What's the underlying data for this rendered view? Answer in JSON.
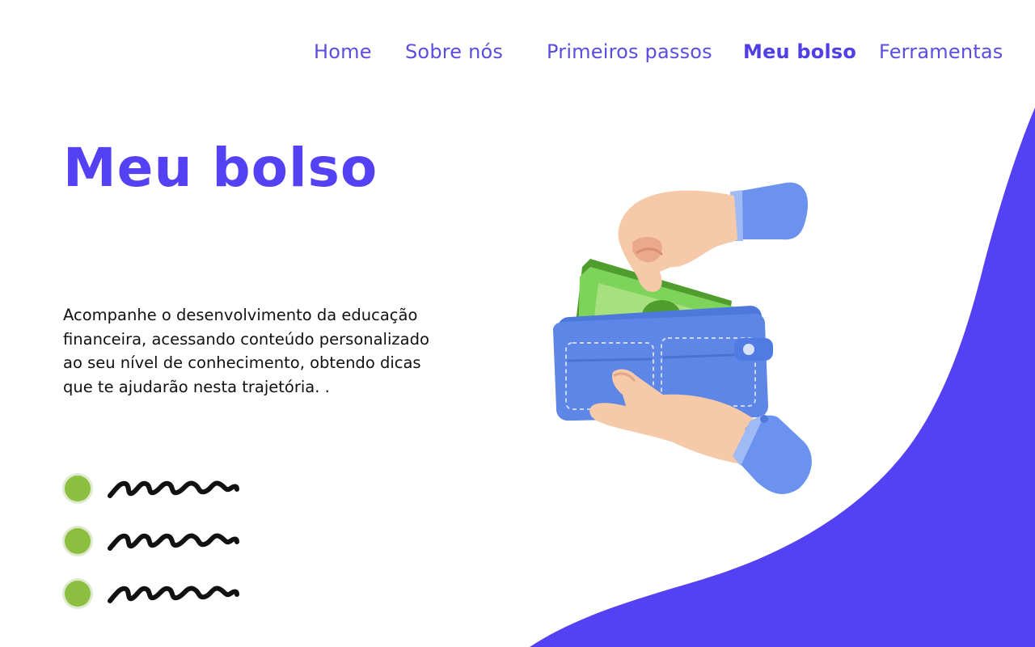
{
  "nav": {
    "items": [
      {
        "label": "Home"
      },
      {
        "label": "Sobre nós"
      },
      {
        "label": "Primeiros passos"
      },
      {
        "label": "Meu bolso",
        "active": true
      },
      {
        "label": "Ferramentas"
      }
    ]
  },
  "hero": {
    "title": "Meu bolso",
    "description": "Acompanhe o desenvolvimento da  educação financeira, acessando  conteúdo personalizado ao seu nível de conhecimento, obtendo dicas que te ajudarão nesta trajetória. ."
  },
  "bullets": [
    {
      "icon": "green-dot-icon"
    },
    {
      "icon": "green-dot-icon"
    },
    {
      "icon": "green-dot-icon"
    }
  ],
  "illustration": {
    "icon": "hand-wallet-money-icon"
  },
  "colors": {
    "accent": "#5441f4",
    "nav_text": "#5a4de0",
    "bullet_dot": "#8cbf3f",
    "wallet": "#5d86e6",
    "cash": "#6cc24a",
    "skin": "#f6c9a8"
  }
}
